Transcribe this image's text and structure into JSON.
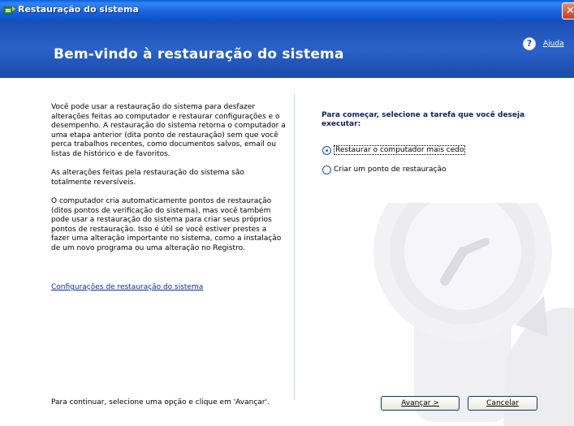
{
  "window": {
    "title": "Restauração do sistema"
  },
  "header": {
    "title": "Bem-vindo à restauração do sistema",
    "help_label": "Ajuda"
  },
  "intro": {
    "paragraphs": [
      "Você pode usar a restauração do sistema para desfazer alterações feitas ao computador e restaurar configurações e o desempenho. A restauração do sistema retorna o computador a uma etapa anterior (dita ponto de restauração) sem que você perca trabalhos recentes, como documentos salvos, email ou listas de histórico e de favoritos.",
      "As alterações feitas pela restauração do sistema são totalmente reversíveis.",
      "O computador cria automaticamente pontos de restauração (ditos pontos de verificação do sistema), mas você também pode usar a restauração do sistema para criar seus próprios pontos de restauração. Isso é útil se você estiver prestes a fazer uma alteração importante no sistema, como a instalação de um novo programa ou uma alteração no Registro."
    ],
    "settings_link": "Configurações de restauração do sistema"
  },
  "task": {
    "prompt": "Para começar, selecione a tarefa que você deseja executar:",
    "options": [
      {
        "label": "Restaurar o computador mais cedo",
        "selected": true
      },
      {
        "label": "Criar um ponto de restauração",
        "selected": false
      }
    ]
  },
  "footer": {
    "instruction": "Para continuar, selecione uma opção e clique em 'Avançar'.",
    "next_label": "Avançar >",
    "cancel_label": "Cancelar"
  },
  "colors": {
    "titlebar": "#1a64de",
    "header": "#2a62c8",
    "link": "#0b2ea0",
    "prompt": "#11205a"
  }
}
